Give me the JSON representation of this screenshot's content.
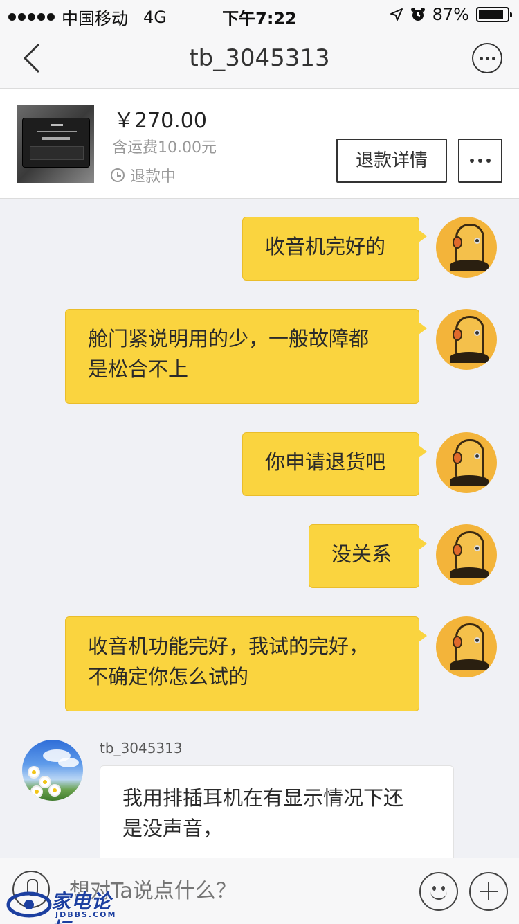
{
  "status_bar": {
    "carrier": "中国移动",
    "network": "4G",
    "time": "下午7:22",
    "battery": "87%",
    "battery_level": 0.87
  },
  "nav": {
    "title": "tb_3045313"
  },
  "order": {
    "price": "￥270.00",
    "shipping": "含运费10.00元",
    "status": "退款中",
    "refund_detail_label": "退款详情"
  },
  "messages": [
    {
      "direction": "out",
      "text": "收音机完好的"
    },
    {
      "direction": "out",
      "text_lines": [
        "舱门紧说明用的少，一般故障都",
        "是松合不上"
      ]
    },
    {
      "direction": "out",
      "text": "你申请退货吧"
    },
    {
      "direction": "out",
      "text": "没关系"
    },
    {
      "direction": "out",
      "text_lines": [
        "收音机功能完好，我试的完好，",
        "不确定你怎么试的"
      ]
    },
    {
      "direction": "in",
      "sender": "tb_3045313",
      "text_lines": [
        "我用排插耳机在有显示情况下还",
        "是没声音，"
      ]
    }
  ],
  "input": {
    "placeholder": "想对Ta说点什么？"
  },
  "watermark": {
    "text": "家电论坛",
    "sub": "JDBBS.COM"
  }
}
